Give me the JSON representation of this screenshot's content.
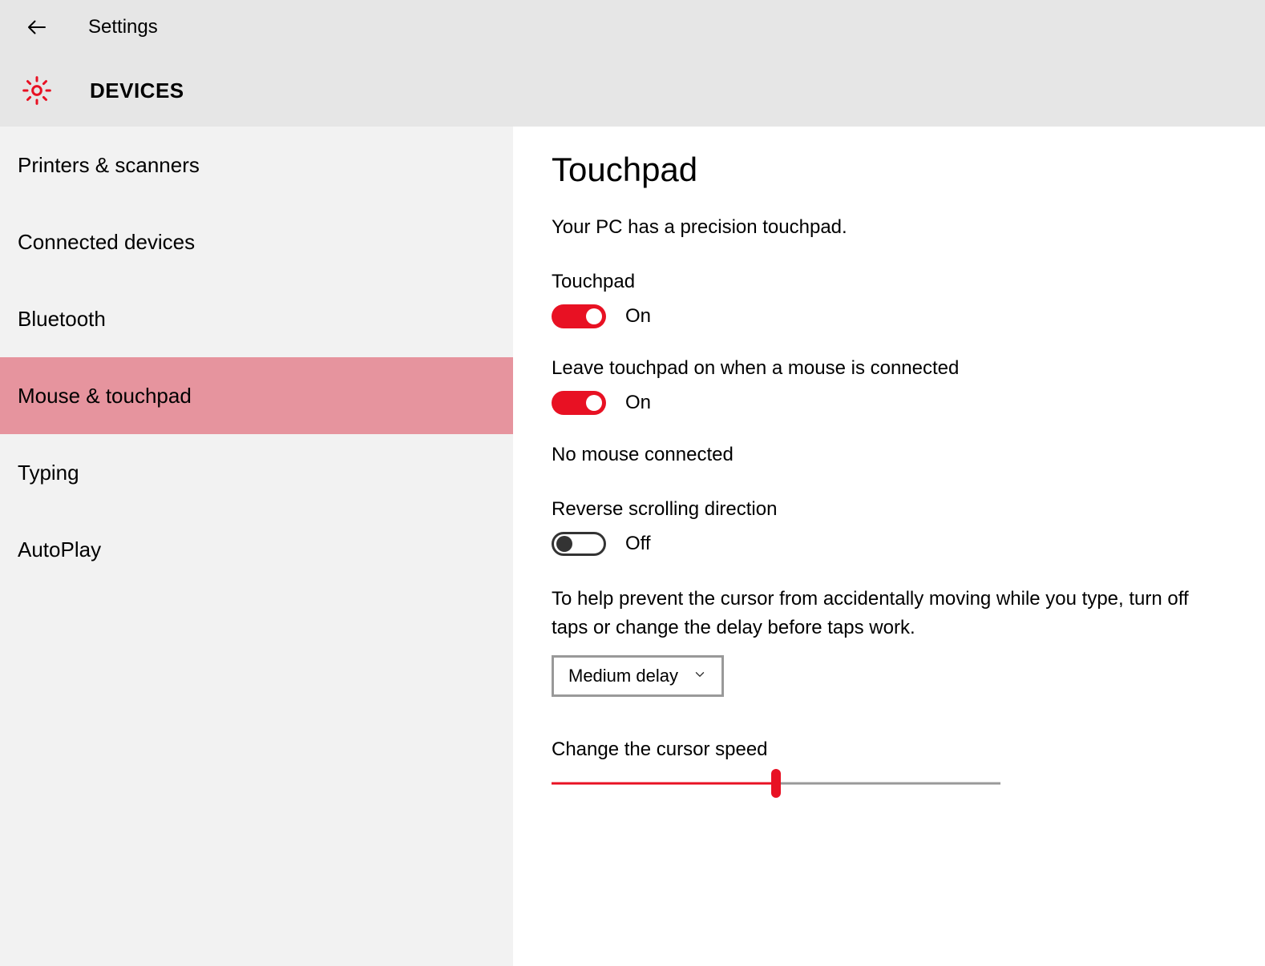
{
  "header": {
    "title": "Settings",
    "section": "DEVICES"
  },
  "sidebar": {
    "items": [
      {
        "label": "Printers & scanners",
        "active": false
      },
      {
        "label": "Connected devices",
        "active": false
      },
      {
        "label": "Bluetooth",
        "active": false
      },
      {
        "label": "Mouse & touchpad",
        "active": true
      },
      {
        "label": "Typing",
        "active": false
      },
      {
        "label": "AutoPlay",
        "active": false
      }
    ]
  },
  "main": {
    "heading": "Touchpad",
    "description": "Your PC has a precision touchpad.",
    "touchpad_toggle": {
      "label": "Touchpad",
      "state": "On",
      "on": true
    },
    "leave_on_toggle": {
      "label": "Leave touchpad on when a mouse is connected",
      "state": "On",
      "on": true
    },
    "mouse_status": "No mouse connected",
    "reverse_toggle": {
      "label": "Reverse scrolling direction",
      "state": "Off",
      "on": false
    },
    "tap_help": "To help prevent the cursor from accidentally moving while you type, turn off taps or change the delay before taps work.",
    "delay_select": {
      "value": "Medium delay"
    },
    "cursor_speed": {
      "label": "Change the cursor speed",
      "percent": 50
    },
    "accent_color": "#e81123"
  }
}
